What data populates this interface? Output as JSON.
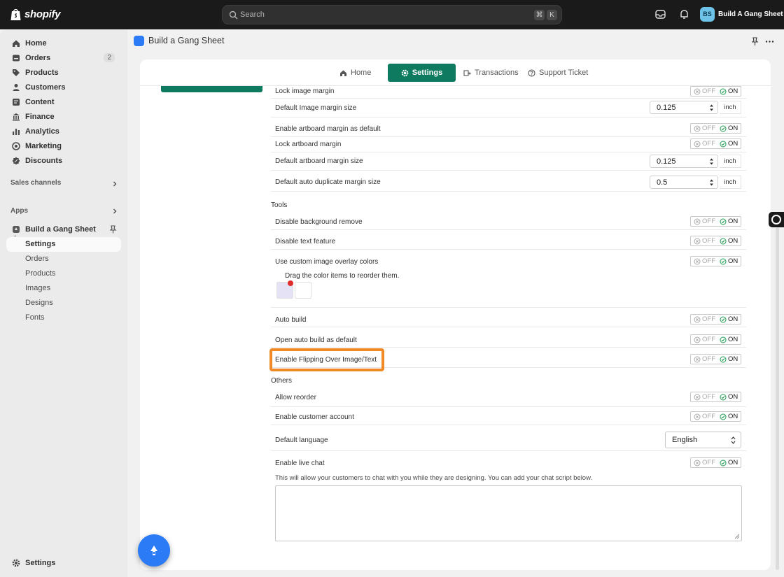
{
  "topbar": {
    "brand": "shopify",
    "search_placeholder": "Search",
    "shortcut_cmd": "⌘",
    "shortcut_key": "K",
    "store_initials": "BS",
    "store_name": "Build A Gang Sheet"
  },
  "sidebar": {
    "items": [
      {
        "label": "Home",
        "icon": "home-icon"
      },
      {
        "label": "Orders",
        "icon": "orders-icon",
        "badge": "2"
      },
      {
        "label": "Products",
        "icon": "tag-icon"
      },
      {
        "label": "Customers",
        "icon": "person-icon"
      },
      {
        "label": "Content",
        "icon": "content-icon"
      },
      {
        "label": "Finance",
        "icon": "bank-icon"
      },
      {
        "label": "Analytics",
        "icon": "chart-icon"
      },
      {
        "label": "Marketing",
        "icon": "target-icon"
      },
      {
        "label": "Discounts",
        "icon": "discount-icon"
      }
    ],
    "sales_channels": "Sales channels",
    "apps": "Apps",
    "app_name": "Build a Gang Sheet",
    "app_subitems": [
      "Settings",
      "Orders",
      "Products",
      "Images",
      "Designs",
      "Fonts"
    ],
    "settings": "Settings"
  },
  "app_header": {
    "title": "Build a Gang Sheet"
  },
  "tabs": [
    "Home",
    "Settings",
    "Transactions",
    "Support Ticket"
  ],
  "toggle": {
    "off": "OFF",
    "on": "ON"
  },
  "unit_label": "inch",
  "rows": {
    "lock_image_margin": "Lock image margin",
    "default_image_margin_size": "Default Image margin size",
    "image_margin_value": "0.125",
    "enable_artboard_margin": "Enable artboard margin as default",
    "lock_artboard_margin": "Lock artboard margin",
    "default_artboard_margin_size": "Default artboard margin size",
    "artboard_margin_value": "0.125",
    "default_auto_duplicate": "Default auto duplicate margin size",
    "auto_duplicate_value": "0.5",
    "tools_heading": "Tools",
    "disable_bg_remove": "Disable background remove",
    "disable_text": "Disable text feature",
    "custom_overlay": "Use custom image overlay colors",
    "drag_hint": "Drag the color items to reorder them.",
    "auto_build": "Auto build",
    "open_auto_build": "Open auto build as default",
    "enable_flipping": "Enable Flipping Over Image/Text",
    "others_heading": "Others",
    "allow_reorder": "Allow reorder",
    "enable_customer_account": "Enable customer account",
    "default_language": "Default language",
    "language_value": "English",
    "enable_live_chat": "Enable live chat",
    "live_chat_help": "This will allow your customers to chat with you while they are designing. You can add your chat script below."
  },
  "colors": {
    "accent": "#0e7a5f",
    "highlight": "#f08a24",
    "app_blue": "#2a7bf5",
    "swatch_dot": "#e02b2b"
  }
}
